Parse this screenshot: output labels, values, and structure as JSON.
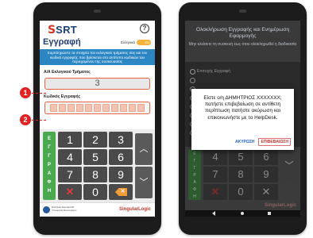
{
  "left_screen": {
    "logo_mark": "S",
    "logo_text": "SRT",
    "help_icon": "?",
    "title": "Εγγραφή",
    "language_label": "Ελληνικά",
    "language_toggle": "EN",
    "info_banner": "Συμπληρώστε τα στοιχεία του εκλογικού τμήματος σας και τον κωδικό εγγραφής που βρίσκεται στο αντίτυπο κωδικών του περιεχομένου της συσκευασίας",
    "fields": {
      "department_label": "Α/Α Εκλογικού Τμήματος",
      "department_value": "3",
      "code_label": "Κωδικός Εγγραφής"
    },
    "keypad": {
      "register_label": "Ε\nΓ\nΓ\nΡ\nΑ\nΦ\nΗ",
      "keys": [
        "1",
        "2",
        "3",
        "4",
        "5",
        "6",
        "7",
        "8",
        "9",
        "✕",
        "0",
        "✕"
      ],
      "arrow_up": "︿",
      "arrow_down": "﹀"
    },
    "footer": {
      "gov_text": "Ελληνική Δημοκρατία Υπουργείο Εσωτερικών",
      "brand": "SingularLogic"
    }
  },
  "callouts": [
    "1",
    "2"
  ],
  "right_screen": {
    "header_title": "Ολοκλήρωση Εγγραφής και Ενημέρωση Εφαρμογής",
    "header_sub": "Μην κλείσετε τη συσκευή έως ότου ολοκληρωθεί η διαδικασία",
    "radio_label": "Επιτυχής Εγγραφή",
    "dialog": {
      "message": "Είστε ο/η ΔΗΜΗΤΡΙΟΣ XXXXXXX; πατήστε επιβεβαίωση σε αντίθετη περίπτωση πατήστε ακύρωση και επικοινωνήστε με το HelpDesk.",
      "cancel": "ΑΚΥΡΩΣΗ",
      "confirm": "ΕΠΙΒΕΒΑΙΩΣΗ"
    },
    "keypad": {
      "register_label": "Ε\nΓ\nΓ\nΡ\nΑ\nΦ\nΗ",
      "keys": [
        "4",
        "5",
        "6",
        "7",
        "8",
        "9",
        "✕",
        "0",
        "✕"
      ],
      "arrow_down": "﹀"
    },
    "footer_brand": "SingularLogic"
  },
  "colors": {
    "brand_blue": "#1f3e78",
    "brand_red": "#d43527",
    "banner_blue": "#2c86c4",
    "register_green": "#4aa84f",
    "error_red": "#e8633f",
    "toggle_orange": "#f7b23b",
    "callout_red": "#e02222"
  }
}
